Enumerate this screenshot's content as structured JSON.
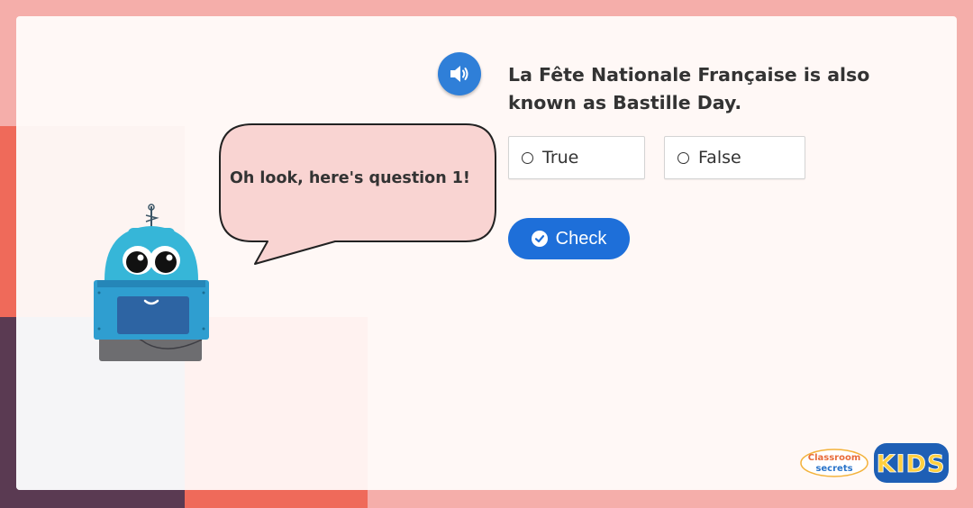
{
  "question": {
    "text": "La Fête Nationale Française is also known as Bastille Day.",
    "audio_icon": "speaker-icon"
  },
  "options": [
    {
      "label": "True",
      "selected": false
    },
    {
      "label": "False",
      "selected": false
    }
  ],
  "check_button": {
    "label": "Check",
    "icon": "check-circle-icon",
    "color": "#1e6fd9"
  },
  "speech_bubble": {
    "text": "Oh look, here's question 1!",
    "fill": "#f9d4d2"
  },
  "brand": {
    "classroom": "Classroom",
    "secrets": "secrets",
    "kids": "KIDS"
  },
  "colors": {
    "frame": "#f5aeaa",
    "card": "#fff8f6",
    "accent_red": "#ef6a5a",
    "accent_plum": "#5a3a52",
    "audio_button": "#2f7fd8"
  }
}
